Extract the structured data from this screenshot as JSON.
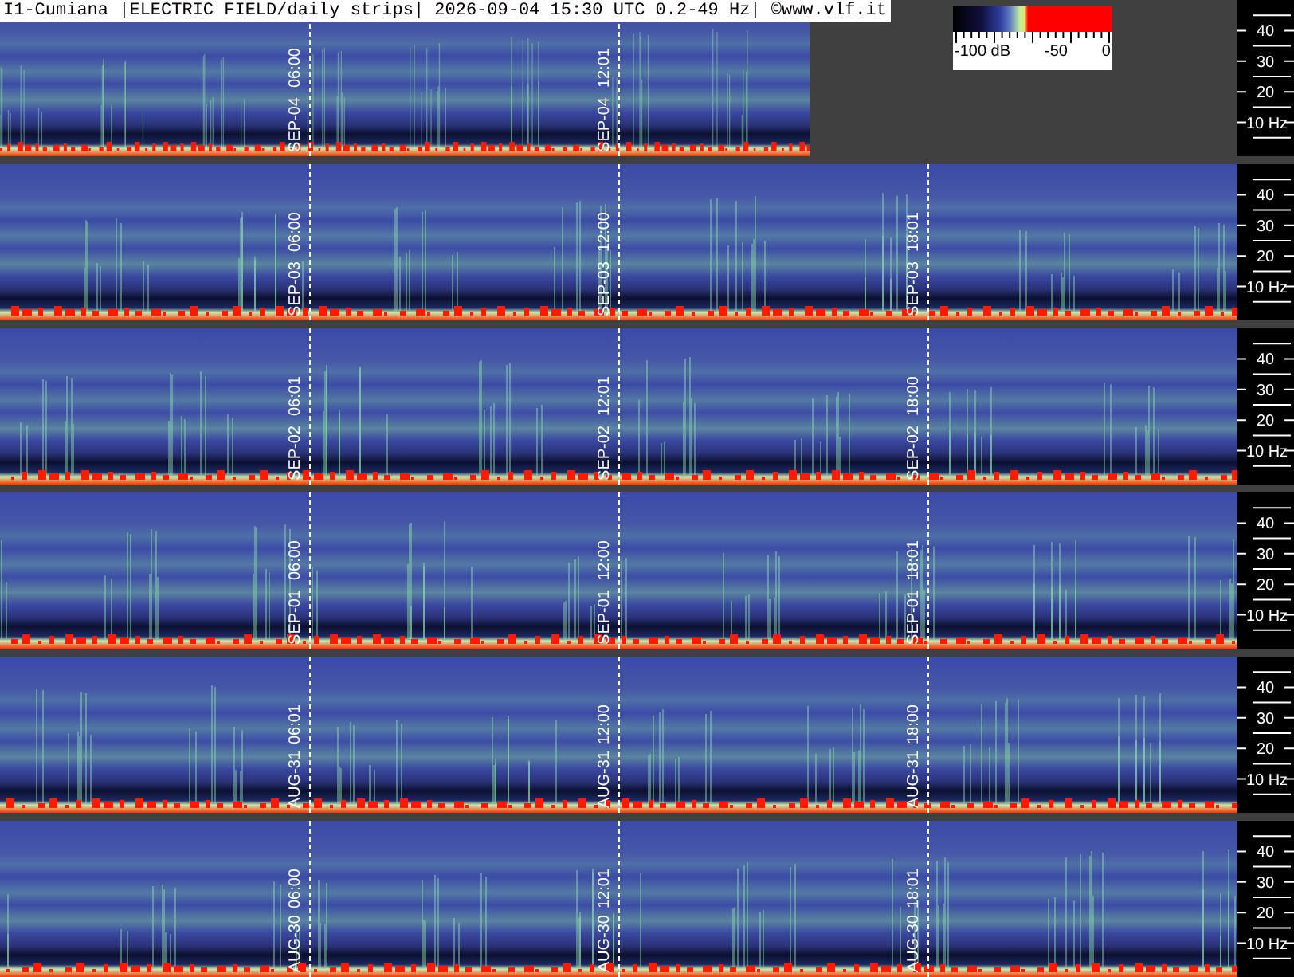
{
  "title": "I1-Cumiana |ELECTRIC FIELD/daily strips| 2026-09-04 15:30 UTC 0.2-49 Hz| ©www.vlf.it",
  "colorbar": {
    "labels": [
      "-100 dB",
      "-50",
      "0"
    ]
  },
  "strips": [
    {
      "level": 0.655,
      "markers": [
        {
          "date": "SEP-04",
          "time": "06:00"
        },
        {
          "date": "SEP-04",
          "time": "12:01"
        }
      ],
      "axis": [
        "40",
        "30",
        "20",
        "10 Hz"
      ]
    },
    {
      "level": 1,
      "markers": [
        {
          "date": "SEP-03",
          "time": "06:00"
        },
        {
          "date": "SEP-03",
          "time": "12:00"
        },
        {
          "date": "SEP-03",
          "time": "18:01"
        }
      ],
      "axis": [
        "40",
        "30",
        "20",
        "10 Hz"
      ]
    },
    {
      "level": 1,
      "markers": [
        {
          "date": "SEP-02",
          "time": "06:01"
        },
        {
          "date": "SEP-02",
          "time": "12:01"
        },
        {
          "date": "SEP-02",
          "time": "18:00"
        }
      ],
      "axis": [
        "40",
        "30",
        "20",
        "10 Hz"
      ]
    },
    {
      "level": 1,
      "markers": [
        {
          "date": "SEP-01",
          "time": "06:00"
        },
        {
          "date": "SEP-01",
          "time": "12:00"
        },
        {
          "date": "SEP-01",
          "time": "18:01"
        }
      ],
      "axis": [
        "40",
        "30",
        "20",
        "10 Hz"
      ]
    },
    {
      "level": 1,
      "markers": [
        {
          "date": "AUG-31",
          "time": "06:01"
        },
        {
          "date": "AUG-31",
          "time": "12:00"
        },
        {
          "date": "AUG-31",
          "time": "18:00"
        }
      ],
      "axis": [
        "40",
        "30",
        "20",
        "10 Hz"
      ]
    },
    {
      "level": 1,
      "markers": [
        {
          "date": "AUG-30",
          "time": "06:00"
        },
        {
          "date": "AUG-30",
          "time": "12:01"
        },
        {
          "date": "AUG-30",
          "time": "18:01"
        }
      ],
      "axis": [
        "40",
        "30",
        "20",
        "10 Hz"
      ]
    }
  ]
}
